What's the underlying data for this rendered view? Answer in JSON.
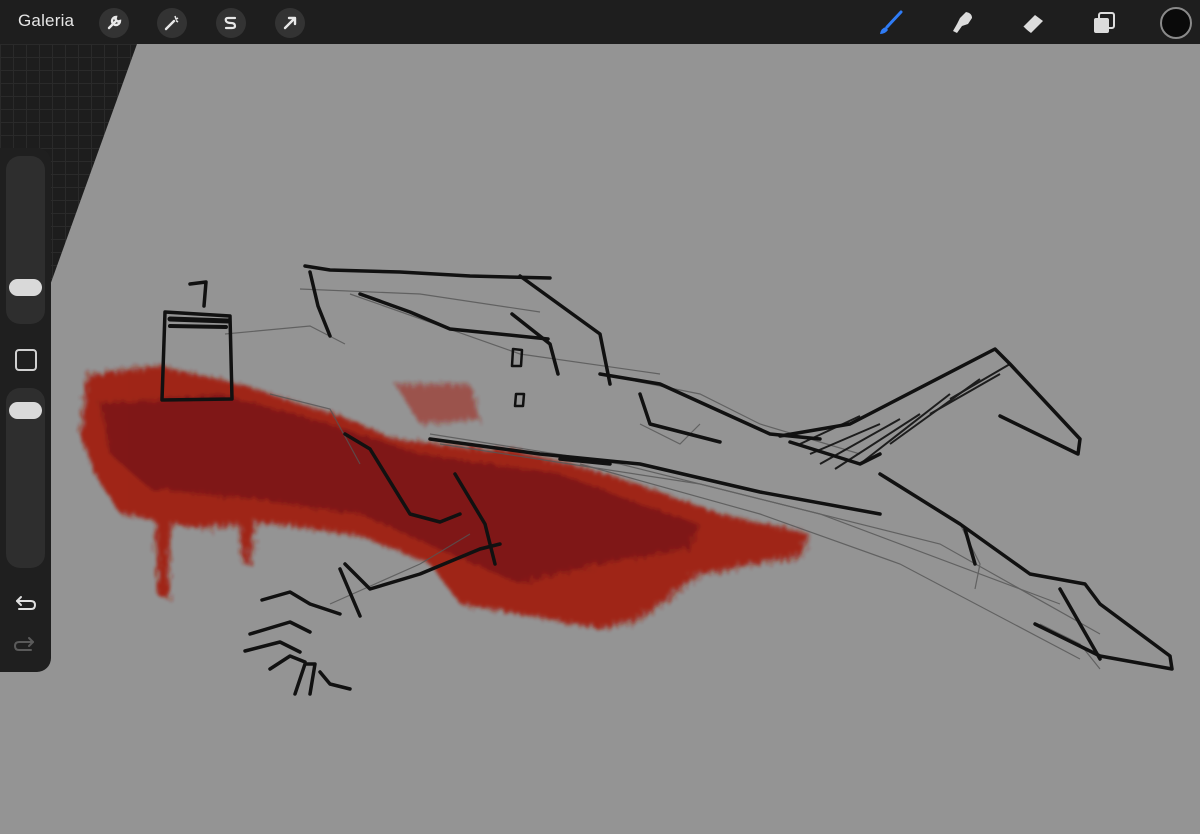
{
  "toolbar": {
    "gallery_label": "Galeria",
    "left_tools": [
      {
        "name": "actions",
        "icon": "wrench-icon"
      },
      {
        "name": "adjustments",
        "icon": "magic-wand-icon"
      },
      {
        "name": "selection",
        "icon": "selection-s-icon"
      },
      {
        "name": "transform",
        "icon": "arrow-cursor-icon"
      }
    ],
    "right_tools": [
      {
        "name": "brush",
        "icon": "brush-icon",
        "active": true,
        "color": "#2f7cf6"
      },
      {
        "name": "smudge",
        "icon": "smudge-icon"
      },
      {
        "name": "eraser",
        "icon": "eraser-icon"
      },
      {
        "name": "layers",
        "icon": "layers-icon"
      }
    ],
    "current_color": "#0a0a0a"
  },
  "sidebar": {
    "controls": [
      "brush-size-slider",
      "modify-button",
      "opacity-slider",
      "undo-icon",
      "redo-icon"
    ]
  },
  "canvas": {
    "background_color": "#949494",
    "stroke_color": "#111111",
    "paint_color": "#a3190c"
  }
}
